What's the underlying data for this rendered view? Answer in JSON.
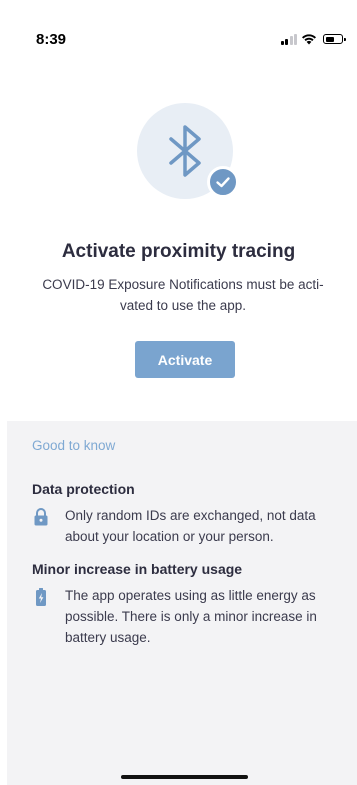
{
  "status_bar": {
    "time": "8:39",
    "icons": [
      "cellular-signal-icon",
      "wifi-icon",
      "battery-icon"
    ]
  },
  "hero": {
    "icon": "bluetooth-icon",
    "badge_icon": "checkmark-icon",
    "title": "Activate proximity tracing",
    "subtitle": "COVID-19 Exposure Notifications must be acti-vated to use the app.",
    "button_label": "Activate"
  },
  "info_panel": {
    "heading": "Good to know",
    "sections": [
      {
        "title": "Data protection",
        "icon": "lock-icon",
        "text": "Only random IDs are exchanged, not data about your location or your person."
      },
      {
        "title": "Minor increase in battery usage",
        "icon": "battery-charging-icon",
        "text": "The app operates using as little energy as possible. There is only a minor increase in battery usage."
      }
    ]
  },
  "colors": {
    "accent": "#7aa4cf",
    "icon_blue": "#6f98c4",
    "hero_circle": "#e8eef5",
    "panel_bg": "#f3f3f5",
    "link_text": "#7fa9d3",
    "heading_text": "#2d2d3f"
  }
}
